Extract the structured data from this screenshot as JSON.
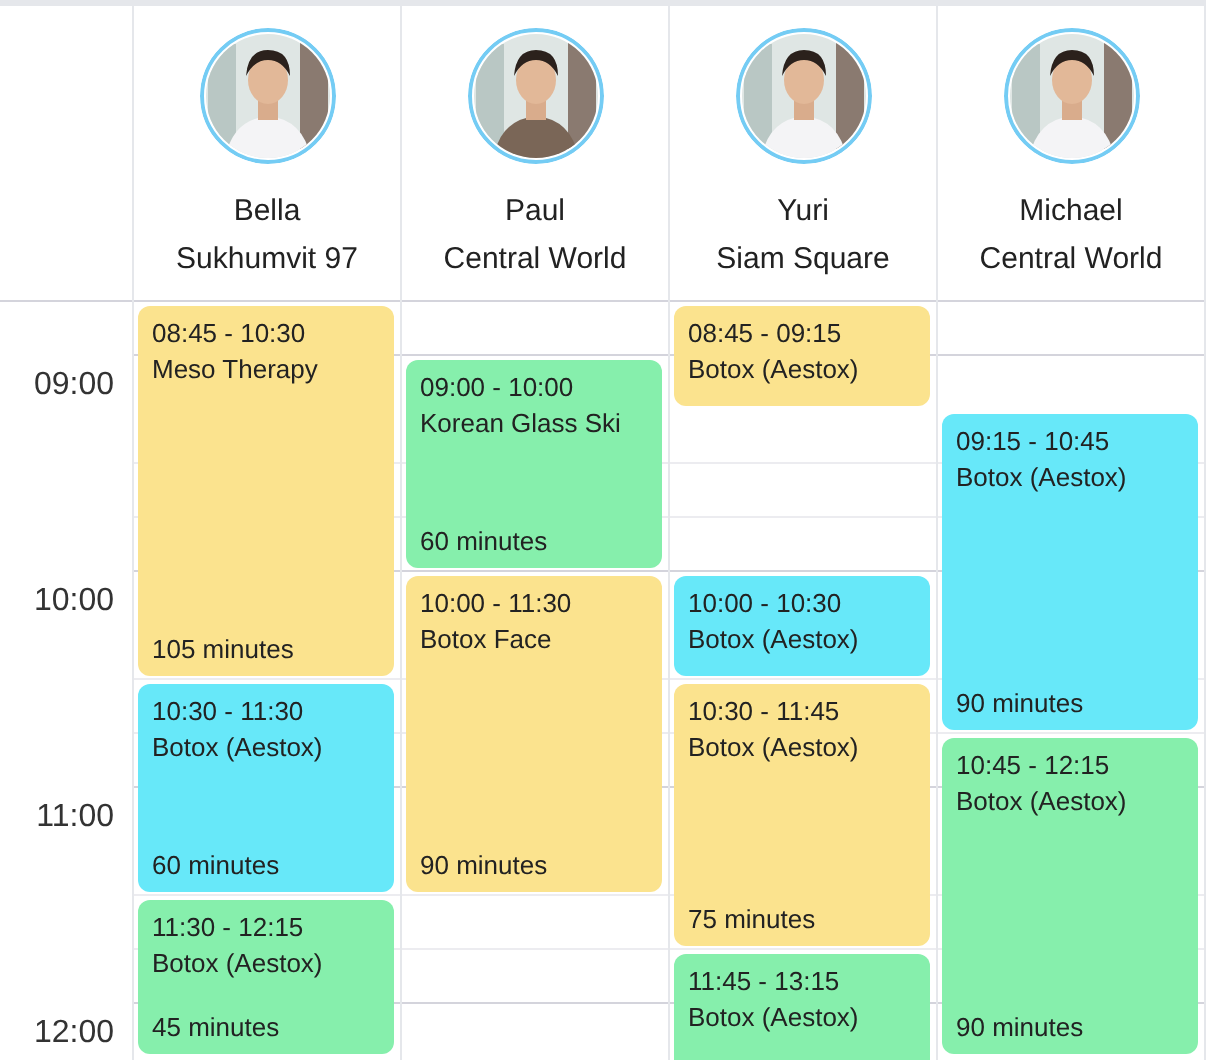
{
  "times": [
    "09:00",
    "10:00",
    "11:00",
    "12:00"
  ],
  "staff": [
    {
      "name": "Bella",
      "branch": "Sukhumvit 97",
      "appointments": [
        {
          "time": "08:45 - 10:30",
          "service": "Meso Therapy",
          "duration": "105 minutes",
          "color": "#fbe38e"
        },
        {
          "time": "10:30 - 11:30",
          "service": "Botox (Aestox)",
          "duration": "60 minutes",
          "color": "#67e8f9"
        },
        {
          "time": "11:30 - 12:15",
          "service": "Botox (Aestox)",
          "duration": "45 minutes",
          "color": "#86efac"
        }
      ]
    },
    {
      "name": "Paul",
      "branch": "Central World",
      "appointments": [
        {
          "time": "09:00 - 10:00",
          "service": "Korean Glass Ski",
          "duration": "60 minutes",
          "color": "#86efac"
        },
        {
          "time": "10:00 - 11:30",
          "service": "Botox Face",
          "duration": "90 minutes",
          "color": "#fbe38e"
        }
      ]
    },
    {
      "name": "Yuri",
      "branch": "Siam Square",
      "appointments": [
        {
          "time": "08:45 - 09:15",
          "service": "Botox (Aestox)",
          "color": "#fbe38e"
        },
        {
          "time": "10:00 - 10:30",
          "service": "Botox (Aestox)",
          "color": "#67e8f9"
        },
        {
          "time": "10:30 - 11:45",
          "service": "Botox (Aestox)",
          "duration": "75 minutes",
          "color": "#fbe38e"
        },
        {
          "time": "11:45 - 13:15",
          "service": "Botox (Aestox)",
          "color": "#86efac"
        }
      ]
    },
    {
      "name": "Michael",
      "branch": "Central World",
      "appointments": [
        {
          "time": "09:15 - 10:45",
          "service": "Botox (Aestox)",
          "duration": "90 minutes",
          "color": "#67e8f9"
        },
        {
          "time": "10:45 - 12:15",
          "service": "Botox (Aestox)",
          "duration": "90 minutes",
          "color": "#86efac"
        }
      ]
    }
  ]
}
